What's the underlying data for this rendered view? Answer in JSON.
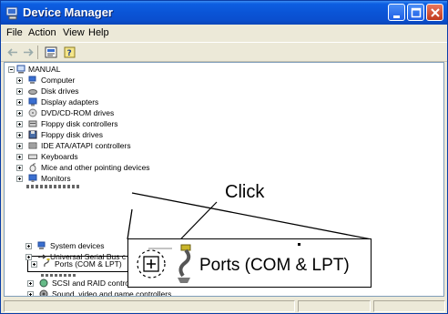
{
  "window": {
    "title": "Device Manager"
  },
  "menubar": {
    "items": [
      "File",
      "Action",
      "View",
      "Help"
    ]
  },
  "tree": {
    "root": "MANUAL",
    "items": [
      "Computer",
      "Disk drives",
      "Display adapters",
      "DVD/CD-ROM drives",
      "Floppy disk controllers",
      "Floppy disk drives",
      "IDE ATA/ATAPI controllers",
      "Keyboards",
      "Mice and other pointing devices",
      "Monitors",
      "Ports (COM & LPT)",
      "SCSI and RAID controllers",
      "Sound, video and game controllers",
      "System devices",
      "Universal Serial Bus c"
    ]
  },
  "annotation": {
    "click_label": "Click",
    "zoom_label": "Ports (COM & LPT)"
  }
}
